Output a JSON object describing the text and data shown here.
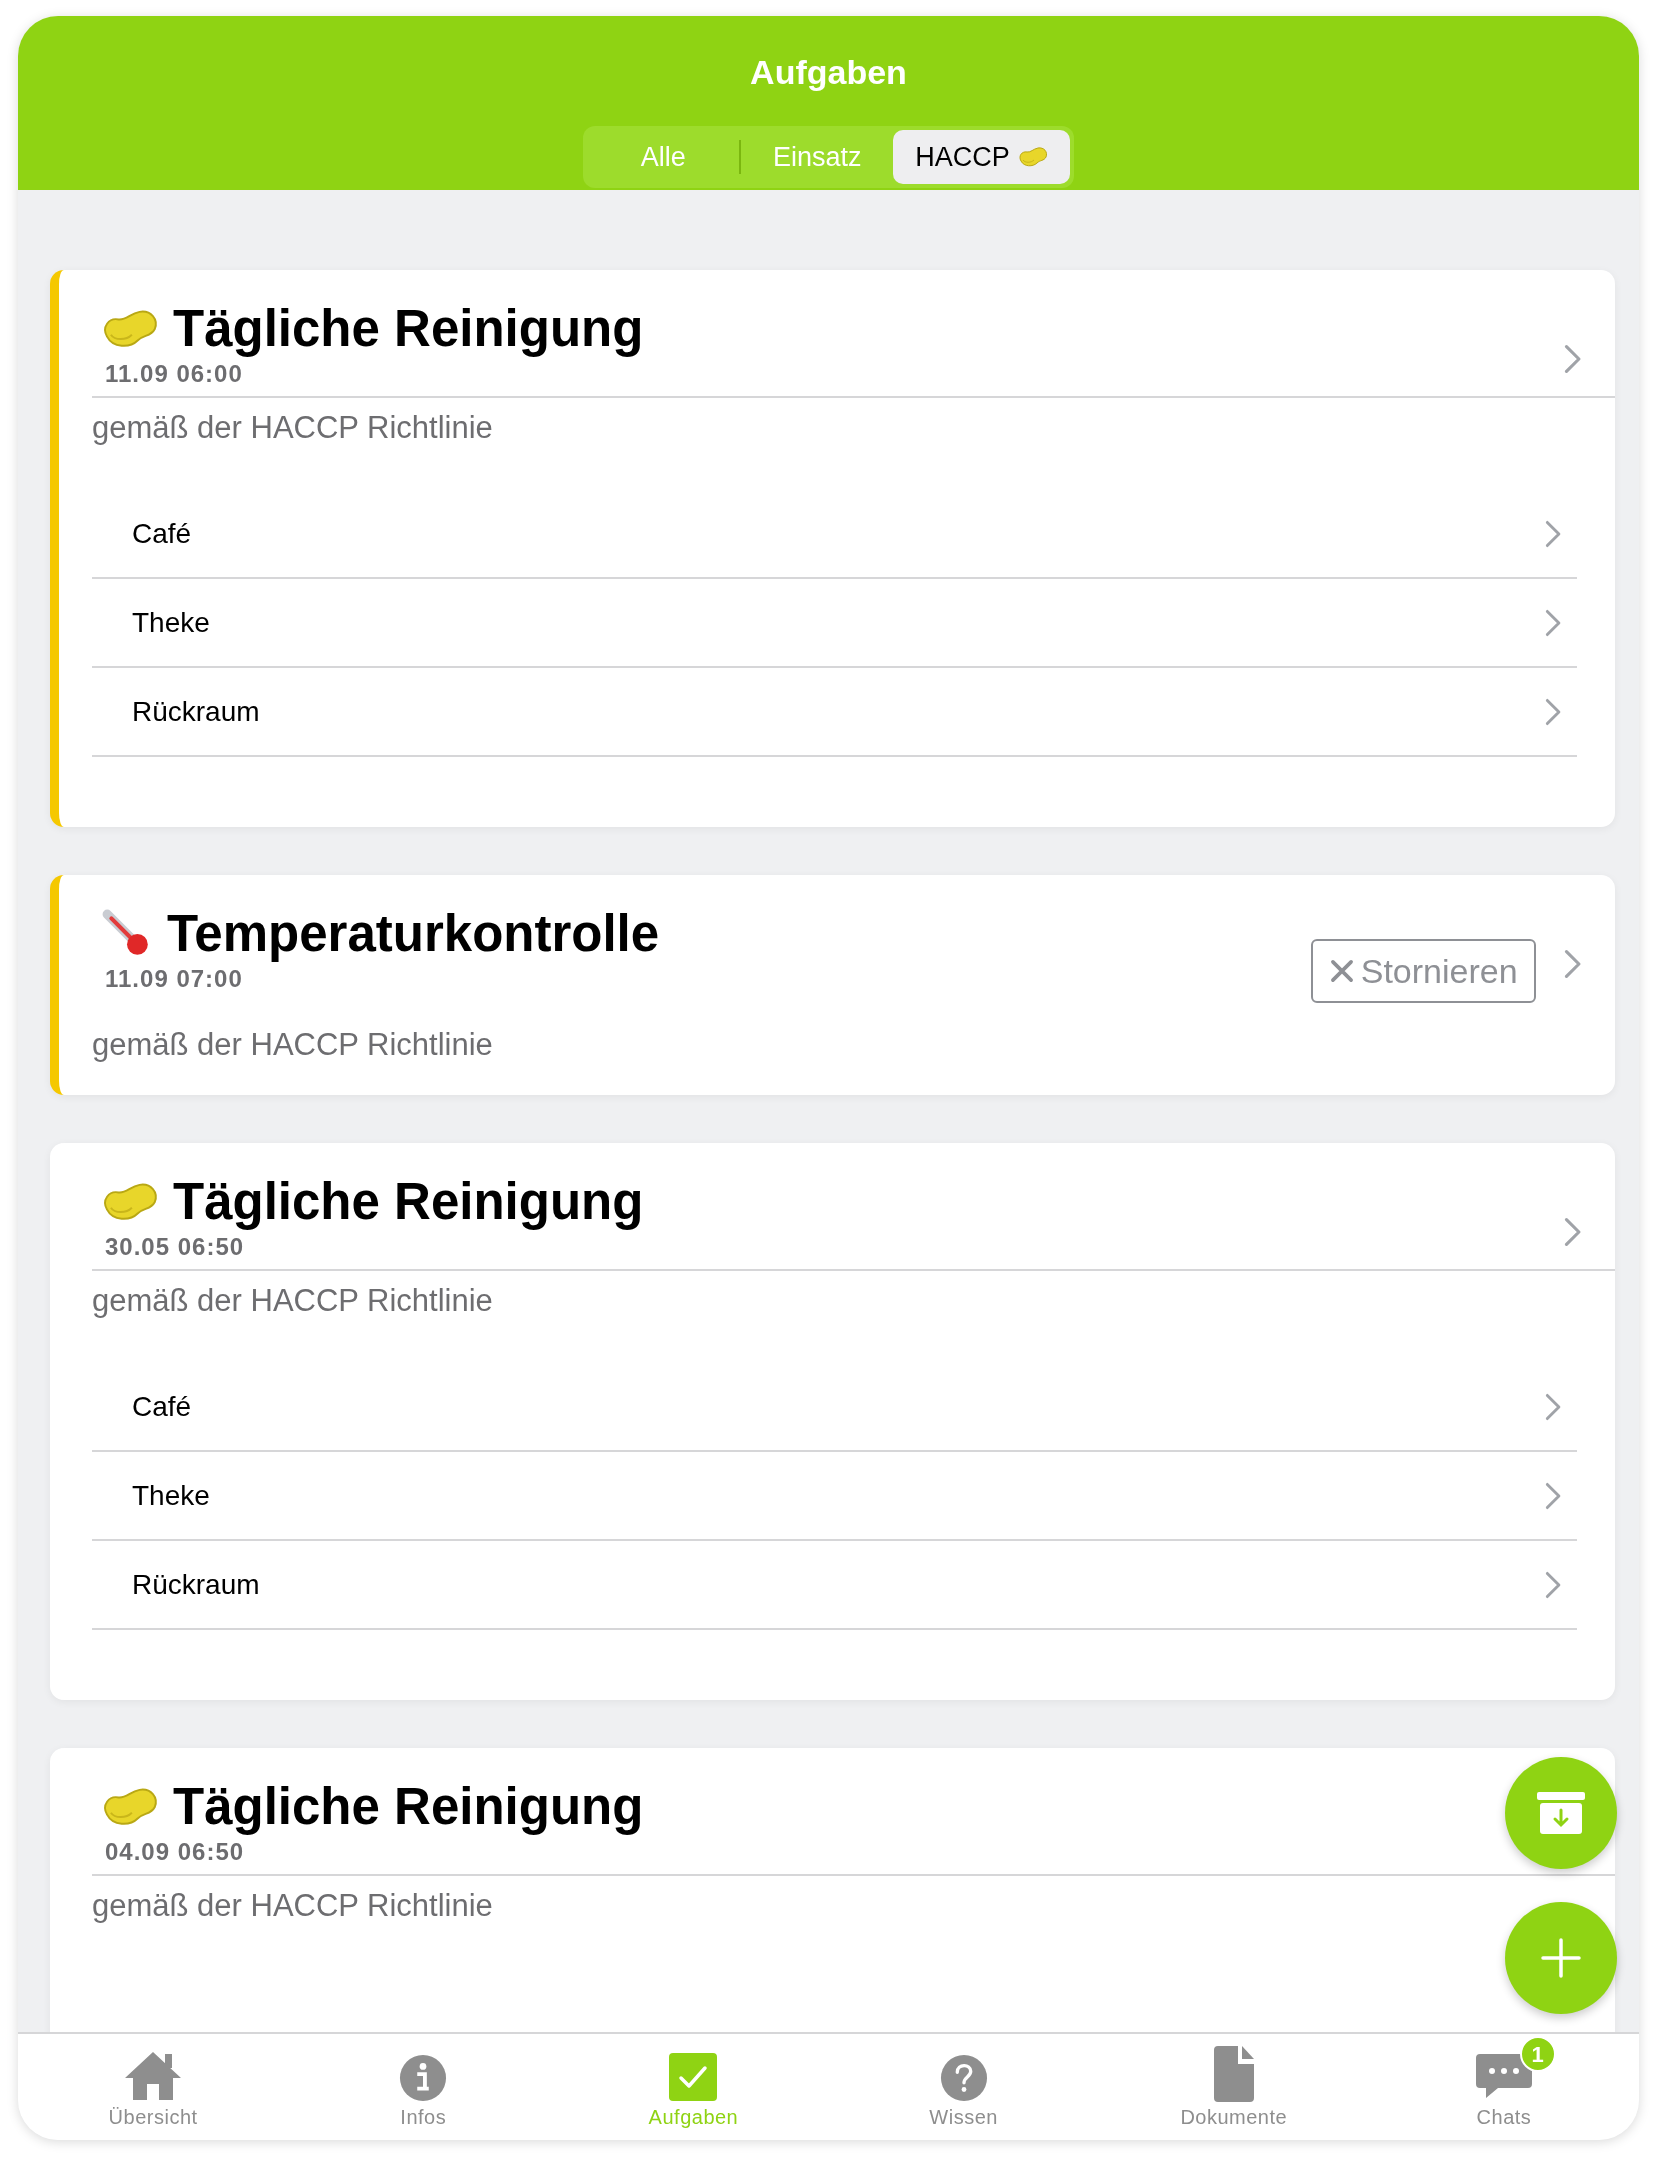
{
  "header": {
    "title": "Aufgaben"
  },
  "filter_tabs": [
    {
      "label": "Alle",
      "selected": false,
      "icon": false
    },
    {
      "label": "Einsatz",
      "selected": false,
      "icon": false
    },
    {
      "label": "HACCP",
      "selected": true,
      "icon": true
    }
  ],
  "tasks": [
    {
      "kind": "sponge",
      "marked": true,
      "title": "Tägliche Reinigung",
      "time": "11.09 06:00",
      "subtitle": "gemäß der HACCP Richtlinie",
      "items": [
        "Café",
        "Theke",
        "Rückraum"
      ]
    },
    {
      "kind": "thermometer",
      "marked": true,
      "title": "Temperaturkontrolle",
      "time": "11.09 07:00",
      "subtitle": "gemäß der HACCP Richtlinie",
      "cancel_label": "Stornieren"
    },
    {
      "kind": "sponge",
      "marked": false,
      "title": "Tägliche Reinigung",
      "time": "30.05 06:50",
      "subtitle": "gemäß der HACCP Richtlinie",
      "items": [
        "Café",
        "Theke",
        "Rückraum"
      ]
    },
    {
      "kind": "sponge",
      "marked": false,
      "title": "Tägliche Reinigung",
      "time": "04.09 06:50",
      "subtitle": "gemäß der HACCP Richtlinie"
    }
  ],
  "tab_bar": [
    {
      "kind": "home",
      "label": "Übersicht",
      "selected": false
    },
    {
      "kind": "info",
      "label": "Infos",
      "selected": false
    },
    {
      "kind": "check",
      "label": "Aufgaben",
      "selected": true
    },
    {
      "kind": "question",
      "label": "Wissen",
      "selected": false
    },
    {
      "kind": "document",
      "label": "Dokumente",
      "selected": false
    },
    {
      "kind": "chat",
      "label": "Chats",
      "selected": false,
      "badge": "1"
    }
  ]
}
